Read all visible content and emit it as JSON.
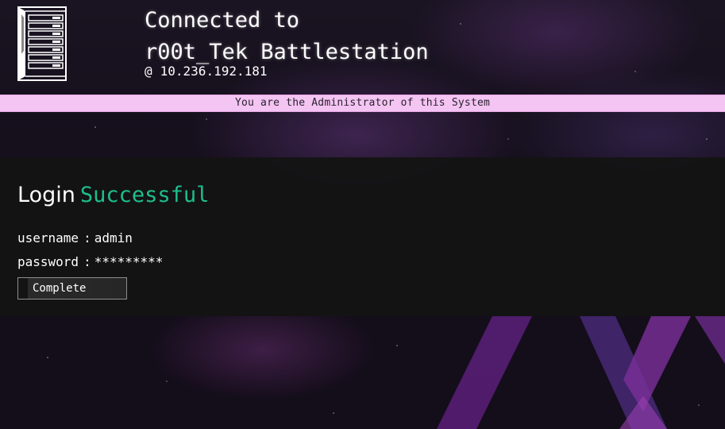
{
  "header": {
    "connected_line": "Connected to",
    "station_name": "r00t_Tek Battlestation",
    "at_symbol": "@",
    "ip_address": "10.236.192.181"
  },
  "banner": {
    "text": "You are the Administrator of this System"
  },
  "login": {
    "heading_word": "Login",
    "status_word": "Successful",
    "username_label": "username",
    "username_value": "admin",
    "password_label": "password",
    "password_value": "*********",
    "separator": ":",
    "complete_label": "Complete"
  },
  "colors": {
    "accent_success": "#1ebf8c",
    "banner_background": "#f4c4f2",
    "panel_background": "#141414"
  },
  "icons": {
    "server": "server-rack-icon"
  }
}
